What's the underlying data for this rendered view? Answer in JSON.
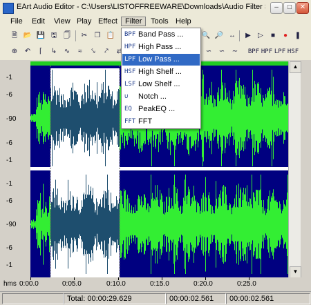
{
  "window": {
    "title": "EArt Audio Editor - C:\\Users\\LISTOFFREEWARE\\Downloads\\Audio Filter Software\\..."
  },
  "menubar": {
    "items": [
      "File",
      "Edit",
      "View",
      "Play",
      "Effect",
      "Filter",
      "Tools",
      "Help"
    ],
    "active": "Filter"
  },
  "filter_menu": {
    "items": [
      {
        "icon": "BPF",
        "label": "Band Pass ..."
      },
      {
        "icon": "HPF",
        "label": "High Pass ..."
      },
      {
        "icon": "LPF",
        "label": "Low Pass ..."
      },
      {
        "icon": "HSF",
        "label": "High Shelf ..."
      },
      {
        "icon": "LSF",
        "label": "Low Shelf ..."
      },
      {
        "icon": "notch-icon",
        "label": "Notch ..."
      },
      {
        "icon": "EQ",
        "label": "PeakEQ ..."
      },
      {
        "icon": "FFT",
        "label": "FFT"
      }
    ],
    "highlighted": "Low Pass ..."
  },
  "toolbar_right": {
    "filter_buttons": [
      "BPF",
      "HPF",
      "LPF",
      "HSF"
    ]
  },
  "ruler": {
    "labels": [
      "-1",
      "-6",
      "-90",
      "-6",
      "-1",
      "-1",
      "-6",
      "-90",
      "-6",
      "-1"
    ]
  },
  "timeline": {
    "unit": "hms",
    "labels": [
      "0:00.0",
      "0:05.0",
      "0:10.0",
      "0:15.0",
      "0:20.0",
      "0:25.0"
    ]
  },
  "status": {
    "total": "Total: 00:00:29.629",
    "selection_length": "00:00:02.561",
    "position": "00:00:02.561"
  },
  "colors": {
    "waveform": "#33ee33",
    "waveform_selected": "#1e4e6e",
    "background": "#000080",
    "selection_bg": "#ffffff",
    "menu_highlight": "#316ac5"
  }
}
